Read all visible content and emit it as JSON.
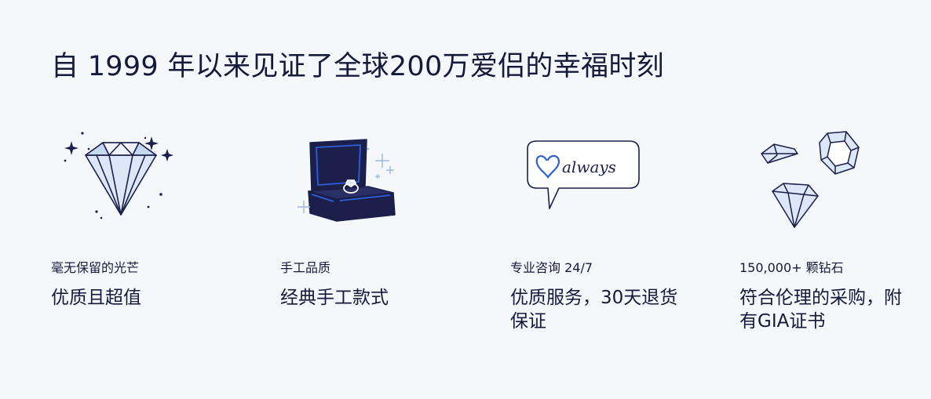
{
  "heading": "自 1999 年以来见证了全球200万爱侣的幸福时刻",
  "features": [
    {
      "icon": "diamond-icon",
      "eyebrow": "毫无保留的光芒",
      "title": "优质且超值"
    },
    {
      "icon": "ring-box-icon",
      "eyebrow": "手工品质",
      "title": "经典手工款式"
    },
    {
      "icon": "speech-bubble-icon",
      "bubble_text": "always",
      "eyebrow": "专业咨询 24/7",
      "title": "优质服务，30天退货保证"
    },
    {
      "icon": "gemstones-icon",
      "eyebrow": "150,000+ 颗钻石",
      "title": "符合伦理的采购，附有GIA证书"
    }
  ],
  "colors": {
    "background": "#f5f8fb",
    "text": "#151a3b",
    "navy": "#1b1f4a",
    "accent_blue": "#2f5fd6",
    "ice_blue": "#dce7f7"
  }
}
